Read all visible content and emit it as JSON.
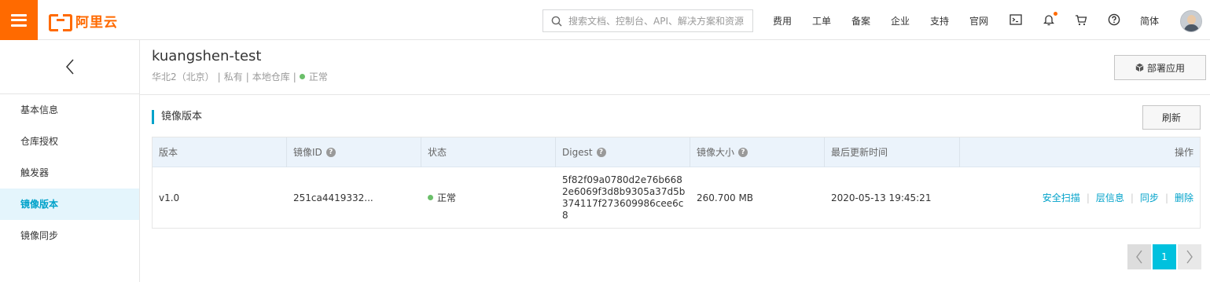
{
  "topbar": {
    "logo_text": "阿里云",
    "search_placeholder": "搜索文档、控制台、API、解决方案和资源",
    "nav": [
      "费用",
      "工单",
      "备案",
      "企业",
      "支持",
      "官网"
    ],
    "lang": "简体",
    "icons": [
      "terminal-icon",
      "bell-icon",
      "cart-icon",
      "help-icon"
    ],
    "accent_color": "#ff6a00"
  },
  "sidebar": {
    "items": [
      {
        "label": "基本信息",
        "active": false
      },
      {
        "label": "仓库授权",
        "active": false
      },
      {
        "label": "触发器",
        "active": false
      },
      {
        "label": "镜像版本",
        "active": true
      },
      {
        "label": "镜像同步",
        "active": false
      }
    ]
  },
  "header": {
    "title": "kuangshen-test",
    "region": "华北2（北京）",
    "visibility": "私有",
    "repo_type": "本地仓库",
    "status": "正常",
    "deploy_label": "部署应用"
  },
  "section": {
    "title": "镜像版本",
    "refresh_label": "刷新"
  },
  "table": {
    "columns": [
      "版本",
      "镜像ID",
      "状态",
      "Digest",
      "镜像大小",
      "最后更新时间",
      "操作"
    ],
    "rows": [
      {
        "version": "v1.0",
        "image_id": "251ca4419332...",
        "status": "正常",
        "digest": "5f82f09a0780d2e76b6682e6069f3d8b9305a37d5b374117f273609986cee6c8",
        "size": "260.700 MB",
        "updated": "2020-05-13 19:45:21",
        "actions": [
          "安全扫描",
          "层信息",
          "同步",
          "删除"
        ]
      }
    ]
  },
  "pagination": {
    "current": "1"
  }
}
